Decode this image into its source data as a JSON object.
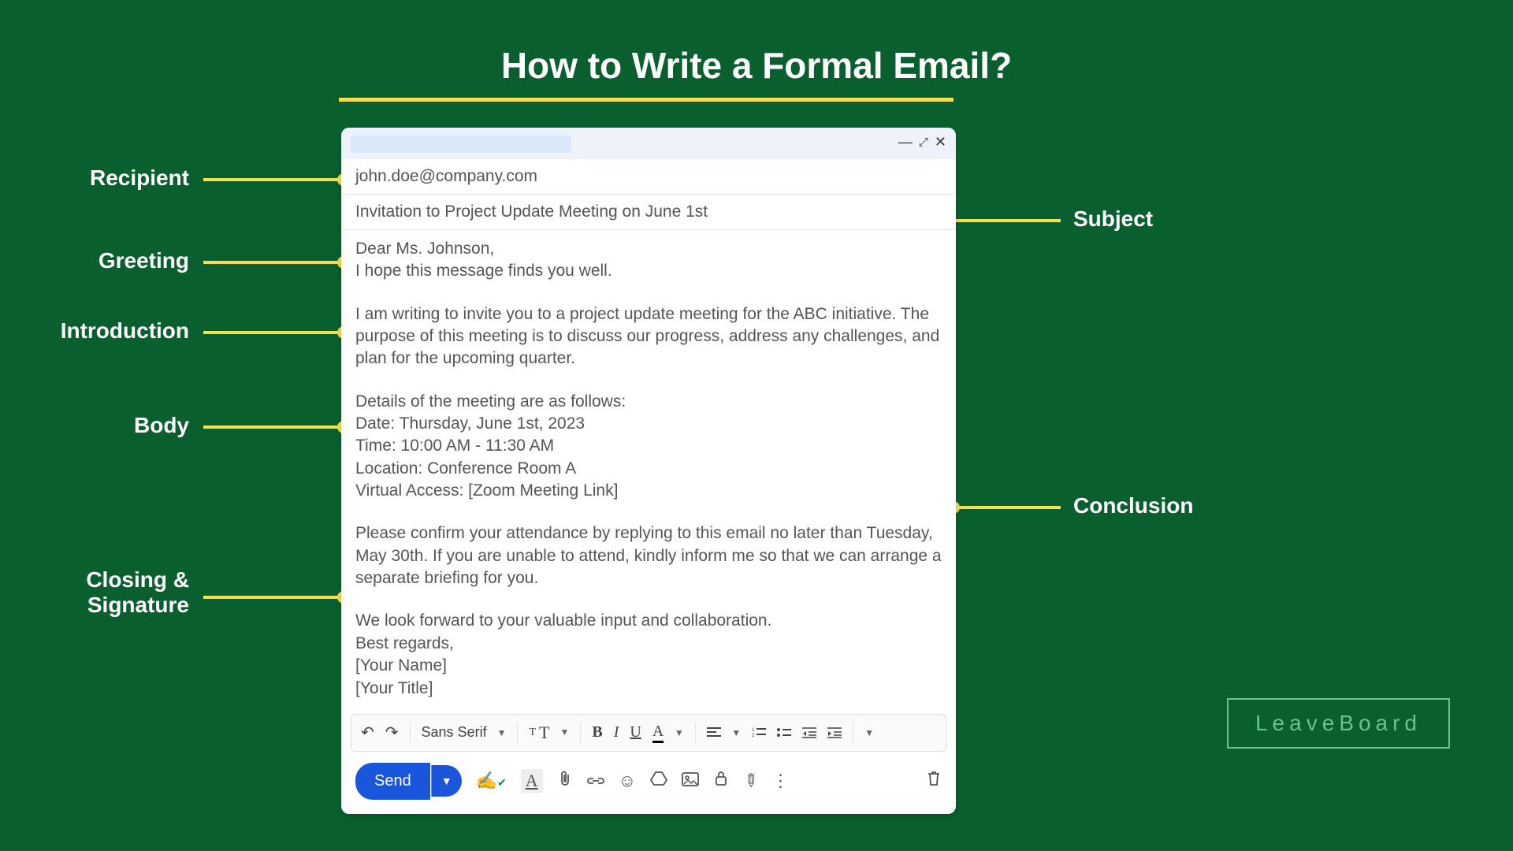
{
  "title": "How to Write a Formal Email?",
  "labels": {
    "recipient": "Recipient",
    "greeting": "Greeting",
    "introduction": "Introduction",
    "body": "Body",
    "closing": "Closing &\nSignature",
    "subject": "Subject",
    "conclusion": "Conclusion"
  },
  "email": {
    "recipient": "john.doe@company.com",
    "subject": "Invitation to Project Update Meeting on June 1st",
    "greeting_line1": "Dear Ms. Johnson,",
    "greeting_line2": "I hope this message finds you well.",
    "intro": "I am writing to invite you to a project update meeting for the ABC initiative. The purpose of this meeting is to discuss our progress, address any challenges, and plan for the upcoming quarter.",
    "body_l1": "Details of the meeting are as follows:",
    "body_l2": "Date: Thursday, June 1st, 2023",
    "body_l3": "Time: 10:00 AM - 11:30 AM",
    "body_l4": "Location: Conference Room A",
    "body_l5": "Virtual Access: [Zoom Meeting Link]",
    "conclusion": "Please confirm your attendance by replying to this email no later than Tuesday, May 30th. If you are unable to attend, kindly inform me so that we can arrange a separate briefing for you.",
    "closing_l1": "We look forward to your valuable input and collaboration.",
    "closing_l2": "Best regards,",
    "closing_l3": "[Your Name]",
    "closing_l4": "[Your Title]"
  },
  "toolbar": {
    "font": "Sans Serif",
    "send": "Send"
  },
  "brand": "LeaveBoard"
}
